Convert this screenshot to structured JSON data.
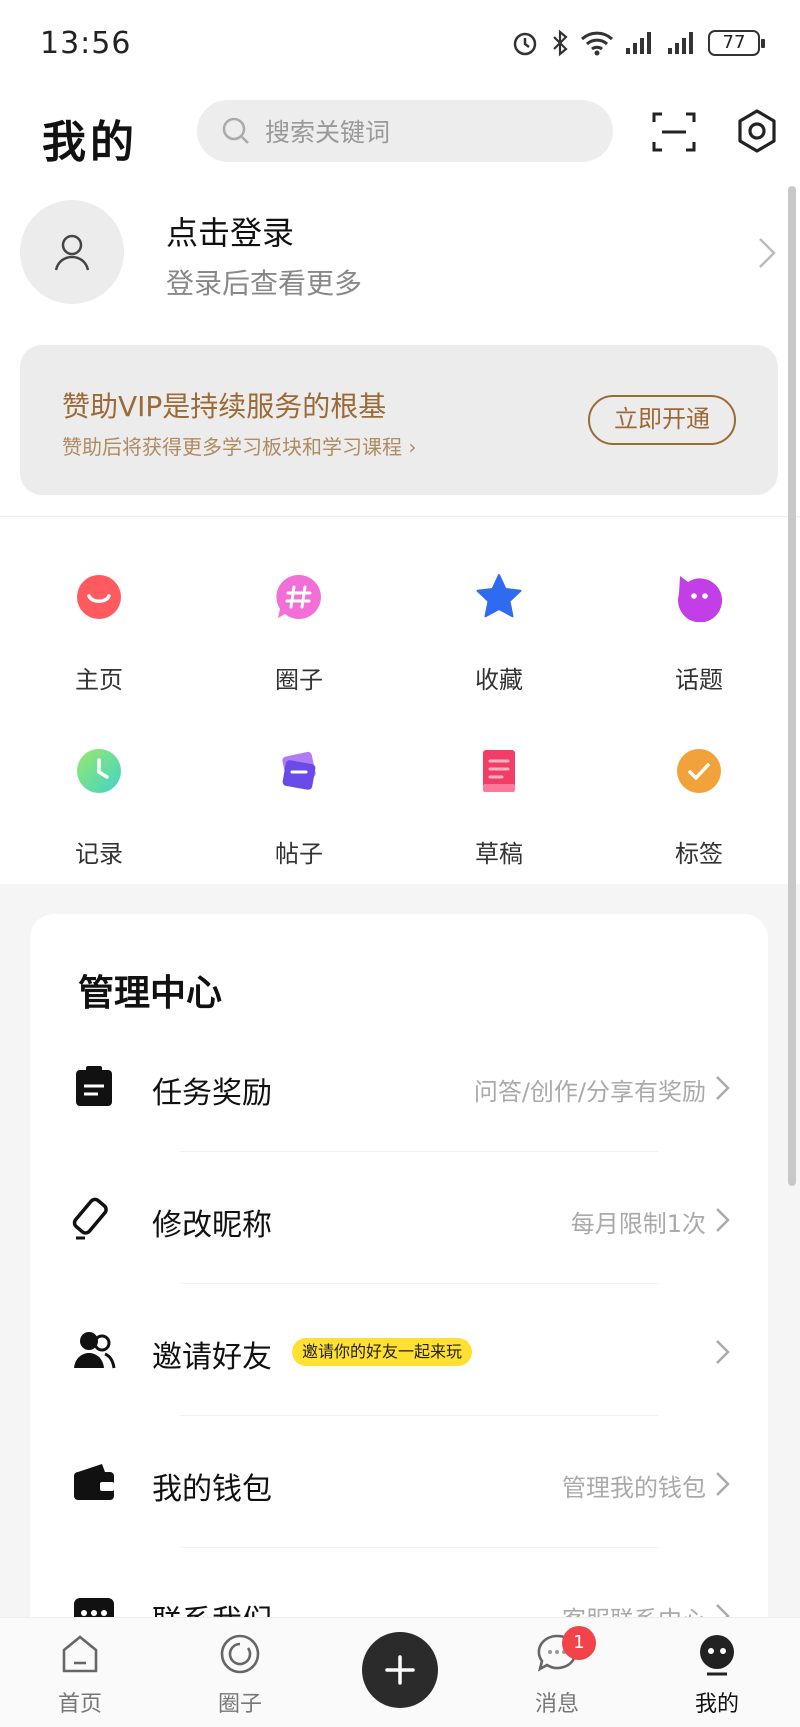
{
  "status": {
    "time": "13:56",
    "battery": "77"
  },
  "header": {
    "title": "我的",
    "search_placeholder": "搜索关键词"
  },
  "profile": {
    "title": "点击登录",
    "subtitle": "登录后查看更多"
  },
  "vip": {
    "title": "赞助VIP是持续服务的根基",
    "subtitle": "赞助后将获得更多学习板块和学习课程 ›",
    "button": "立即开通"
  },
  "shortcuts": [
    {
      "label": "主页",
      "icon": "smile-icon",
      "color": "#ff5a5f"
    },
    {
      "label": "圈子",
      "icon": "hash-icon",
      "color": "#f36fd8"
    },
    {
      "label": "收藏",
      "icon": "star-icon",
      "color": "#2f6bf0"
    },
    {
      "label": "话题",
      "icon": "chat-face-icon",
      "color": "#c23ee6"
    },
    {
      "label": "记录",
      "icon": "clock-icon",
      "color": "#3ed3c9"
    },
    {
      "label": "帖子",
      "icon": "cards-icon",
      "color": "#7a5cf0"
    },
    {
      "label": "草稿",
      "icon": "document-icon",
      "color": "#f23d68"
    },
    {
      "label": "标签",
      "icon": "check-icon",
      "color": "#f2a23a"
    }
  ],
  "manage": {
    "title": "管理中心",
    "items": [
      {
        "label": "任务奖励",
        "hint": "问答/创作/分享有奖励",
        "icon": "clipboard-icon"
      },
      {
        "label": "修改昵称",
        "hint": "每月限制1次",
        "icon": "eraser-icon"
      },
      {
        "label": "邀请好友",
        "hint": "",
        "badge": "邀请你的好友一起来玩",
        "icon": "users-icon"
      },
      {
        "label": "我的钱包",
        "hint": "管理我的钱包",
        "icon": "wallet-icon"
      },
      {
        "label": "联系我们",
        "hint": "客服联系中心",
        "icon": "message-icon"
      }
    ]
  },
  "tabbar": {
    "items": [
      {
        "label": "首页",
        "icon": "home-icon"
      },
      {
        "label": "圈子",
        "icon": "circle-icon"
      },
      {
        "label": "消息",
        "icon": "message-icon",
        "badge": "1"
      },
      {
        "label": "我的",
        "icon": "profile-face-icon"
      }
    ]
  },
  "colors": {
    "accent_gold": "#9b6a36",
    "badge_yellow": "#ffe033",
    "badge_red": "#f2434b"
  }
}
